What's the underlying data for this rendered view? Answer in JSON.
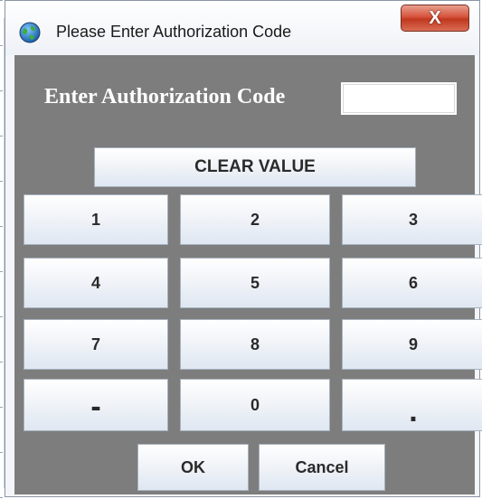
{
  "window": {
    "title": "Please Enter Authorization Code",
    "close_label": "X"
  },
  "dialog": {
    "prompt_label": "Enter Authorization Code",
    "code_value": ""
  },
  "buttons": {
    "clear": "CLEAR VALUE",
    "ok": "OK",
    "cancel": "Cancel"
  },
  "keypad": {
    "k1": "1",
    "k2": "2",
    "k3": "3",
    "k4": "4",
    "k5": "5",
    "k6": "6",
    "k7": "7",
    "k8": "8",
    "k9": "9",
    "minus": "-",
    "k0": "0",
    "dot": "."
  },
  "colors": {
    "panel_background": "#7d7d7d",
    "close_button": "#c0381f"
  },
  "icons": {
    "app": "globe-icon"
  }
}
